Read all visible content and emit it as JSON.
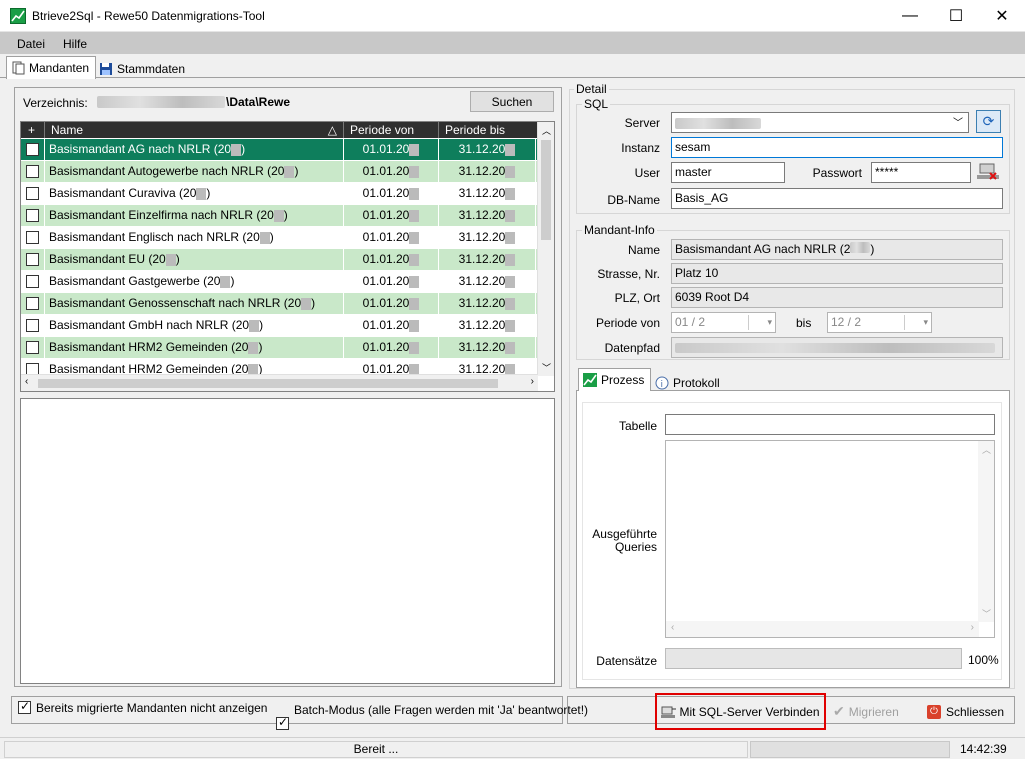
{
  "window": {
    "title": "Btrieve2Sql - Rewe50 Datenmigrations-Tool",
    "minimize": "—",
    "maximize": "☐",
    "close": "✕"
  },
  "menu": [
    "Datei",
    "Hilfe"
  ],
  "tabs": [
    {
      "label": "Mandanten",
      "icon": "document-icon",
      "active": true
    },
    {
      "label": "Stammdaten",
      "icon": "floppy-disk-icon",
      "active": false
    }
  ],
  "directory": {
    "label": "Verzeichnis:",
    "path_suffix": "\\Data\\Rewe",
    "search_button": "Suchen"
  },
  "grid": {
    "headers": [
      "+",
      "Name",
      "Periode von",
      "Periode bis"
    ],
    "rows": [
      {
        "name": "Basismandant AG nach NRLR (20",
        "suffix": ")",
        "from": "01.01.20",
        "to": "31.12.20",
        "style": "sel"
      },
      {
        "name": "Basismandant Autogewerbe nach NRLR (20",
        "suffix": ")",
        "from": "01.01.20",
        "to": "31.12.20",
        "style": "alt"
      },
      {
        "name": "Basismandant Curaviva (20",
        "suffix": ")",
        "from": "01.01.20",
        "to": "31.12.20",
        "style": "norm"
      },
      {
        "name": "Basismandant Einzelfirma nach NRLR (20",
        "suffix": ")",
        "from": "01.01.20",
        "to": "31.12.20",
        "style": "alt"
      },
      {
        "name": "Basismandant Englisch nach NRLR (20",
        "suffix": ")",
        "from": "01.01.20",
        "to": "31.12.20",
        "style": "norm"
      },
      {
        "name": "Basismandant EU (20",
        "suffix": ")",
        "from": "01.01.20",
        "to": "31.12.20",
        "style": "alt"
      },
      {
        "name": "Basismandant Gastgewerbe (20",
        "suffix": ")",
        "from": "01.01.20",
        "to": "31.12.20",
        "style": "norm"
      },
      {
        "name": "Basismandant Genossenschaft nach NRLR (20",
        "suffix": ")",
        "from": "01.01.20",
        "to": "31.12.20",
        "style": "alt"
      },
      {
        "name": "Basismandant GmbH nach NRLR (20",
        "suffix": ")",
        "from": "01.01.20",
        "to": "31.12.20",
        "style": "norm"
      },
      {
        "name": "Basismandant HRM2 Gemeinden (20",
        "suffix": ")",
        "from": "01.01.20",
        "to": "31.12.20",
        "style": "alt"
      },
      {
        "name": "Basismandant HRM2 Gemeinden (20",
        "suffix": ")",
        "from": "01.01.20",
        "to": "31.12.20",
        "style": "norm"
      }
    ]
  },
  "options": {
    "hide_migrated": "Bereits migrierte Mandanten nicht anzeigen",
    "batch_mode": "Batch-Modus (alle Fragen werden mit 'Ja' beantwortet!)"
  },
  "detail": {
    "title": "Detail",
    "sql": {
      "title": "SQL",
      "server_label": "Server",
      "instanz_label": "Instanz",
      "instanz_value": "sesam",
      "user_label": "User",
      "user_value": "master",
      "password_label": "Passwort",
      "password_value": "*****",
      "dbname_label": "DB-Name",
      "dbname_value": "Basis_AG"
    },
    "mandant": {
      "title": "Mandant-Info",
      "name_label": "Name",
      "name_value": "Basismandant AG nach NRLR (2",
      "name_suffix": ")",
      "street_label": "Strasse, Nr.",
      "street_value": "Platz 10",
      "plz_label": "PLZ, Ort",
      "plz_value": "6039 Root D4",
      "period_label": "Periode von",
      "period_from": "01 / 2",
      "period_bis_label": "bis",
      "period_to": "12 / 2",
      "path_label": "Datenpfad"
    },
    "process_tabs": [
      {
        "label": "Prozess",
        "icon": "chart-icon"
      },
      {
        "label": "Protokoll",
        "icon": "info-icon"
      }
    ],
    "process": {
      "table_label": "Tabelle",
      "queries_label": "Ausgeführte Queries",
      "records_label": "Datensätze",
      "records_percent": "100%",
      "progress": 0
    }
  },
  "actions": {
    "connect": "Mit SQL-Server Verbinden",
    "migrate": "Migrieren",
    "close": "Schliessen"
  },
  "statusbar": {
    "text": "Bereit ...",
    "time": "14:42:39"
  }
}
